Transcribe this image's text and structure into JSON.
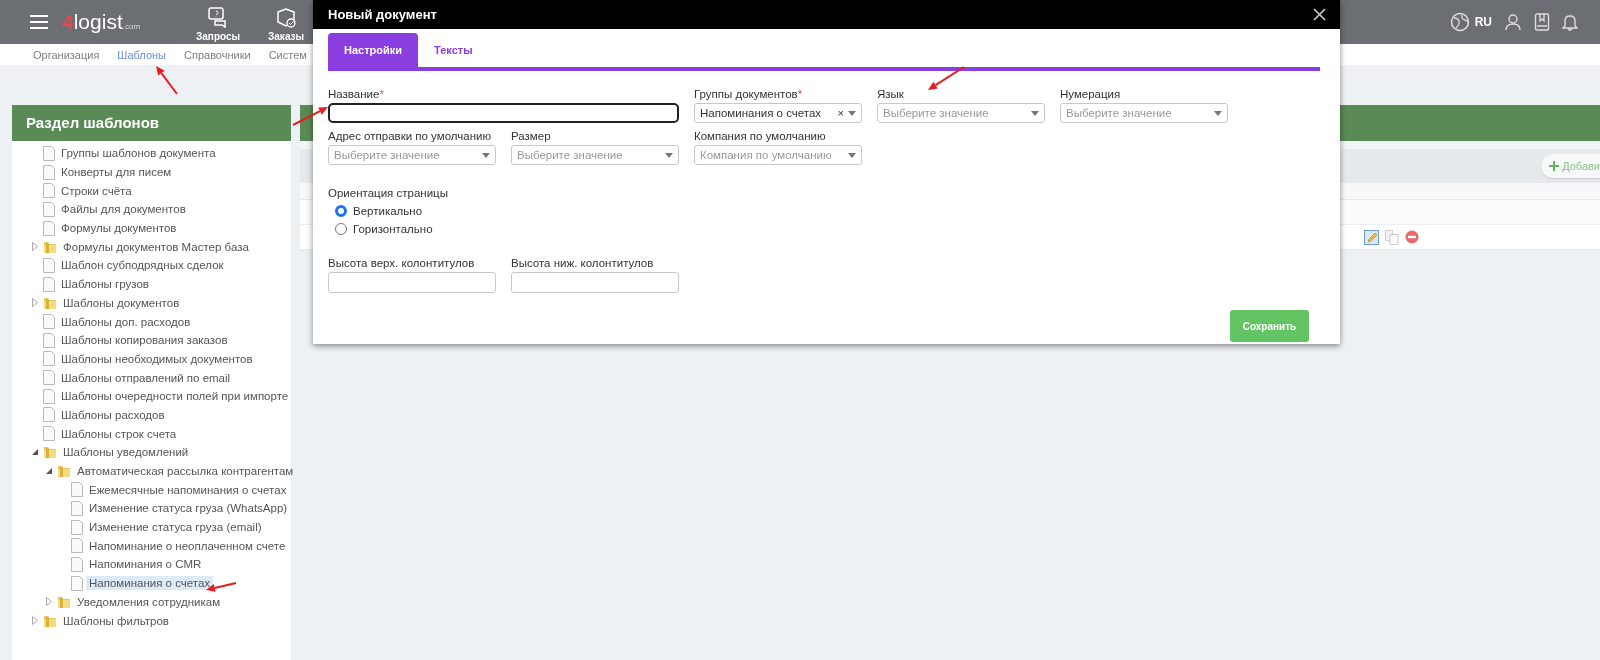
{
  "header": {
    "logo": {
      "mark": "4",
      "name": "logist",
      "suffix": ".com"
    },
    "nav_items": [
      {
        "label": "Запросы",
        "kind": "requests"
      },
      {
        "label": "Заказы",
        "kind": "orders"
      }
    ],
    "language": "RU"
  },
  "subnav": [
    {
      "label": "Организация",
      "selected": false
    },
    {
      "label": "Шаблоны",
      "selected": true
    },
    {
      "label": "Справочники",
      "selected": false
    },
    {
      "label": "Систем",
      "selected": false
    }
  ],
  "sidebar": {
    "title": "Раздел шаблонов",
    "tree": [
      {
        "label": "Группы шаблонов документа",
        "kind": "file",
        "selected": false
      },
      {
        "label": "Конверты для писем",
        "kind": "file",
        "selected": false
      },
      {
        "label": "Строки счёта",
        "kind": "file",
        "selected": false
      },
      {
        "label": "Файлы для документов",
        "kind": "file",
        "selected": false
      },
      {
        "label": "Формулы документов",
        "kind": "file",
        "selected": false
      },
      {
        "label": "Формулы документов Мастер база",
        "kind": "folder",
        "expanded": false,
        "selected": false
      },
      {
        "label": "Шаблон субподрядных сделок",
        "kind": "file",
        "selected": false
      },
      {
        "label": "Шаблоны грузов",
        "kind": "file",
        "selected": false
      },
      {
        "label": "Шаблоны документов",
        "kind": "folder",
        "expanded": false,
        "selected": false
      },
      {
        "label": "Шаблоны доп. расходов",
        "kind": "file",
        "selected": false
      },
      {
        "label": "Шаблоны копирования заказов",
        "kind": "file",
        "selected": false
      },
      {
        "label": "Шаблоны необходимых документов",
        "kind": "file",
        "selected": false
      },
      {
        "label": "Шаблоны отправлений по email",
        "kind": "file",
        "selected": false
      },
      {
        "label": "Шаблоны очередности полей при импорте",
        "kind": "file",
        "selected": false
      },
      {
        "label": "Шаблоны расходов",
        "kind": "file",
        "selected": false
      },
      {
        "label": "Шаблоны строк счета",
        "kind": "file",
        "selected": false
      },
      {
        "label": "Шаблоны уведомлений",
        "kind": "folder",
        "expanded": true,
        "selected": false,
        "children": [
          {
            "label": "Автоматическая рассылка контрагентам",
            "kind": "folder",
            "expanded": true,
            "selected": false,
            "children": [
              {
                "label": "Ежемесячные напоминания о счетах",
                "kind": "file",
                "selected": false
              },
              {
                "label": "Изменение статуса груза (WhatsApp)",
                "kind": "file",
                "selected": false
              },
              {
                "label": "Изменение статуса груза (email)",
                "kind": "file",
                "selected": false
              },
              {
                "label": "Напоминание о неоплаченном счете",
                "kind": "file",
                "selected": false
              },
              {
                "label": "Напоминания о CMR",
                "kind": "file",
                "selected": false
              },
              {
                "label": "Напоминания о счетах",
                "kind": "file",
                "selected": true
              }
            ]
          },
          {
            "label": "Уведомления сотрудникам",
            "kind": "folder",
            "expanded": false,
            "selected": false
          }
        ]
      },
      {
        "label": "Шаблоны фильтров",
        "kind": "folder",
        "expanded": false,
        "selected": false
      }
    ]
  },
  "main": {
    "add_button": "Добави"
  },
  "modal": {
    "title": "Новый документ",
    "tabs": [
      {
        "label": "Настройки",
        "selected": true
      },
      {
        "label": "Тексты",
        "selected": false
      }
    ],
    "form_rows": [
      [
        {
          "kind": "wide",
          "label": "Название",
          "required_mark": "*",
          "focused": true
        },
        {
          "kind": "tagselect",
          "label": "Группы документов",
          "required_mark": "*",
          "value": "Напоминания о счетах",
          "clear": "×"
        },
        {
          "kind": "select",
          "label": "Язык",
          "placeholder": "Выберите значение"
        },
        {
          "kind": "select",
          "label": "Нумерация",
          "placeholder": "Выберите значение"
        }
      ],
      [
        {
          "kind": "select",
          "label": "Адрес отправки по умолчанию",
          "placeholder": "Выберите значение"
        },
        {
          "kind": "select",
          "label": "Размер",
          "placeholder": "Выберите значение"
        },
        {
          "kind": "select",
          "label": "Компания по умолчанию",
          "placeholder": "Компания по умолчанию"
        }
      ]
    ],
    "orientation": {
      "label": "Ориентация страницы",
      "options": [
        {
          "label": "Вертикально",
          "selected": true
        },
        {
          "label": "Горизонтально",
          "selected": false
        }
      ]
    },
    "footer_fields": [
      {
        "kind": "text",
        "label": "Высота верх. колонтитулов"
      },
      {
        "kind": "text",
        "label": "Высота ниж. колонтитулов"
      }
    ],
    "save_button": "Сохранить"
  }
}
